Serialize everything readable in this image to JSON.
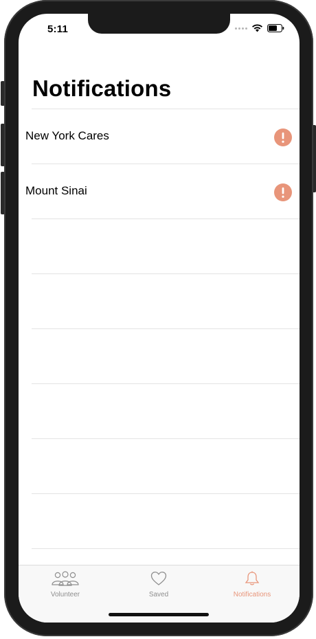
{
  "status_bar": {
    "time": "5:11"
  },
  "page": {
    "title": "Notifications"
  },
  "notifications": [
    {
      "name": "New York Cares",
      "icon": "alert-circle-icon"
    },
    {
      "name": "Mount Sinai",
      "icon": "alert-circle-icon"
    }
  ],
  "tab_bar": {
    "tabs": [
      {
        "label": "Volunteer",
        "icon": "people-icon",
        "active": false
      },
      {
        "label": "Saved",
        "icon": "heart-icon",
        "active": false
      },
      {
        "label": "Notifications",
        "icon": "bell-icon",
        "active": true
      }
    ]
  },
  "colors": {
    "accent": "#e8957a",
    "inactive": "#8e8e8e",
    "separator": "#e3e3e3"
  }
}
